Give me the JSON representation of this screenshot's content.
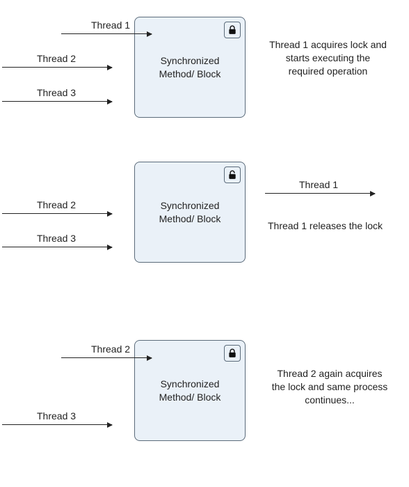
{
  "labels": {
    "thread1": "Thread 1",
    "thread2": "Thread 2",
    "thread3": "Thread 3",
    "sync_block": "Synchronized Method/ Block"
  },
  "stage1": {
    "desc": "Thread 1 acquires lock and starts executing the required operation",
    "lock_state": "locked"
  },
  "stage2": {
    "desc": "Thread 1 releases the lock",
    "lock_state": "unlocked"
  },
  "stage3": {
    "desc": "Thread 2 again acquires the lock and same process continues...",
    "lock_state": "locked"
  }
}
